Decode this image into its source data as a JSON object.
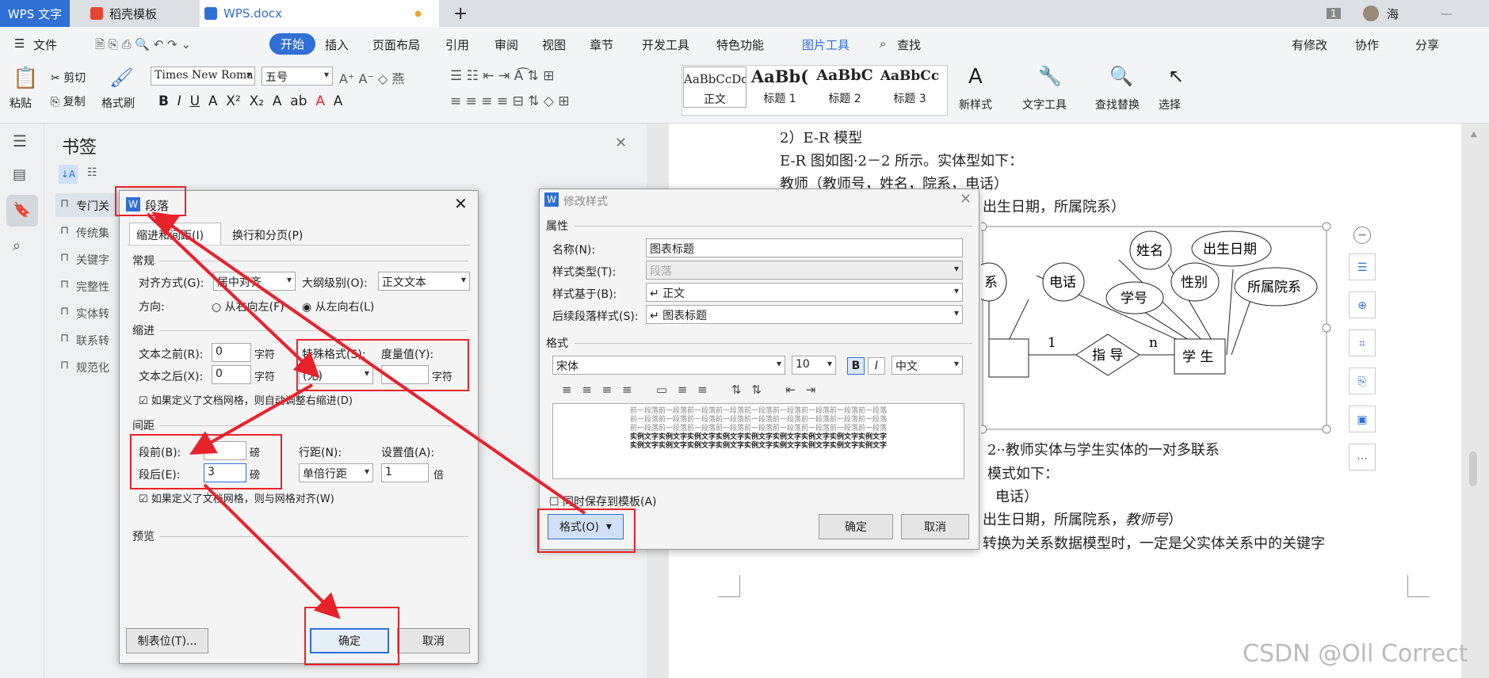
{
  "tabs": [
    "WPS 文字",
    "稻壳模板",
    "WPS.docx"
  ],
  "tabbar": {
    "new_tab": "+",
    "page_count": "1",
    "user": "海"
  },
  "menu": {
    "file": "文件",
    "items": [
      "开始",
      "插入",
      "页面布局",
      "引用",
      "审阅",
      "视图",
      "章节",
      "开发工具",
      "特色功能",
      "图片工具",
      "查找"
    ],
    "right": [
      "有修改",
      "协作",
      "分享"
    ]
  },
  "toolbar": {
    "paste": "粘贴",
    "cut": "剪切",
    "copy": "复制",
    "format_painter": "格式刷",
    "font": "Times New Roma",
    "size": "五号",
    "styles": [
      {
        "sample": "AaBbCcDd",
        "name": "正文"
      },
      {
        "sample": "AaBb(",
        "name": "标题 1"
      },
      {
        "sample": "AaBbC",
        "name": "标题 2"
      },
      {
        "sample": "AaBbCc",
        "name": "标题 3"
      }
    ],
    "new_style": "新样式",
    "text_tools": "文字工具",
    "find_replace": "查找替换",
    "select": "选择"
  },
  "bookmarks": {
    "title": "书签",
    "items": [
      "专门关",
      "传统集",
      "关键字",
      "完整性",
      "实体转",
      "联系转",
      "规范化"
    ]
  },
  "para_dialog": {
    "title": "段落",
    "tabs": [
      "缩进和间距(I)",
      "换行和分页(P)"
    ],
    "general": "常规",
    "align_label": "对齐方式(G):",
    "align_value": "居中对齐",
    "outline_label": "大纲级别(O):",
    "outline_value": "正文文本",
    "direction_label": "方向:",
    "rtl": "从右向左(F)",
    "ltr": "从左向右(L)",
    "indent": "缩进",
    "before_text": "文本之前(R):",
    "before_text_val": "0",
    "after_text": "文本之后(X):",
    "after_text_val": "0",
    "unit_char": "字符",
    "special_label": "特殊格式(S):",
    "special_value": "(无)",
    "measure_label": "度量值(Y):",
    "auto_indent": "如果定义了文档网格，则自动调整右缩进(D)",
    "spacing": "间距",
    "space_before": "段前(B):",
    "space_before_val": "3",
    "space_after": "段后(E):",
    "space_after_val": "3",
    "unit_pound": "磅",
    "line_label": "行距(N):",
    "line_value": "单倍行距",
    "setting_label": "设置值(A):",
    "setting_val": "1",
    "unit_times": "倍",
    "grid_align": "如果定义了文档网格，则与网格对齐(W)",
    "preview": "预览",
    "tabs_btn": "制表位(T)...",
    "ok": "确定",
    "cancel": "取消"
  },
  "style_dialog": {
    "title": "修改样式",
    "props": "属性",
    "name_label": "名称(N):",
    "name_val": "图表标题",
    "type_label": "样式类型(T):",
    "type_val": "段落",
    "based_label": "样式基于(B):",
    "based_val": "↵ 正文",
    "next_label": "后续段落样式(S):",
    "next_val": "↵ 图表标题",
    "format": "格式",
    "font": "宋体",
    "size": "10",
    "bold": "B",
    "italic": "I",
    "lang": "中文",
    "prev_line": "前一段落前一段落前一段落前一段落前一段落前一段落前一段落前一段落前一段落",
    "sample_line": "实例文字实例文字实例文字实例文字实例文字实例文字实例文字实例文字实例文字",
    "save_template": "同时保存到模板(A)",
    "format_btn": "格式(O)",
    "ok": "确定",
    "cancel": "取消"
  },
  "doc": {
    "l1": "2）E-R 模型",
    "l2": "E-R 图如图·2－2 所示。实体型如下：",
    "l3": "教师（教师号，姓名，院系，电话）",
    "l4": "出生日期，所属院系）",
    "caption": "2··教师实体与学生实体的一对多联系",
    "l6": "模式如下：",
    "l7": "电话）",
    "l8": "出生日期，所属院系，",
    "l8i": "教师号",
    "l8e": "）",
    "l9": "转换为关系数据模型时，一定是父实体关系中的关键字",
    "diagram": {
      "attrs": [
        "系",
        "电话",
        "姓名",
        "出生日期",
        "学号",
        "性别",
        "所属院系"
      ],
      "rel": "指 导",
      "one": "1",
      "n": "n",
      "entity": "学 生"
    }
  },
  "watermark": "CSDN @Oll Correct"
}
